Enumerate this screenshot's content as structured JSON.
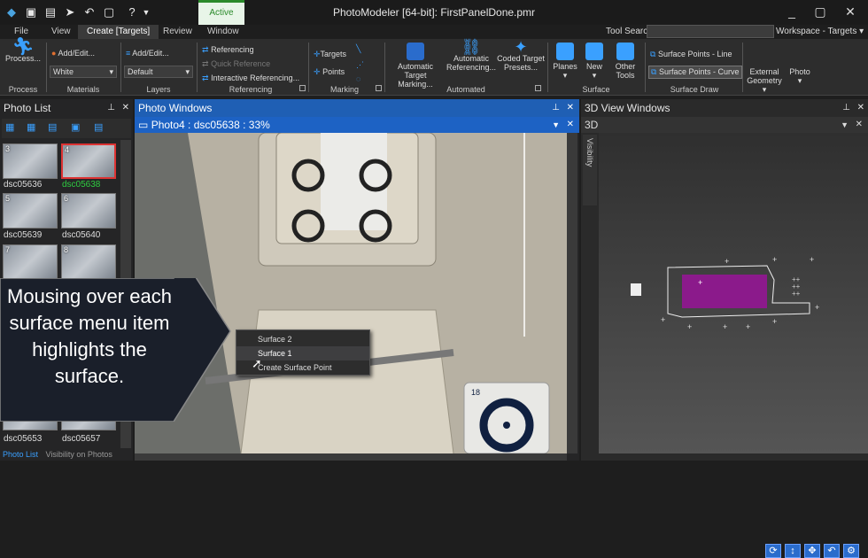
{
  "window": {
    "title": "PhotoModeler [64-bit]: FirstPanelDone.pmr",
    "context_tab": "Active"
  },
  "menu": {
    "tabs": [
      "File",
      "View",
      "Create [Targets]",
      "Review",
      "Window"
    ],
    "tool_search_label": "Tool Search",
    "tool_search_value": "",
    "workspace": "Workspace - Targets"
  },
  "ribbon": {
    "process_btn": "Process...",
    "process_group": "Process",
    "materials_add": "Add/Edit...",
    "materials_value": "White",
    "materials_group": "Materials",
    "layers_add": "Add/Edit...",
    "layers_value": "Default",
    "layers_group": "Layers",
    "ref_referencing": "Referencing",
    "ref_quick": "Quick Reference",
    "ref_interactive": "Interactive Referencing...",
    "ref_group": "Referencing",
    "mark_targets": "Targets",
    "mark_points": "Points",
    "mark_group": "Marking",
    "auto_target": "Automatic Target Marking...",
    "auto_ref": "Automatic Referencing...",
    "coded_target": "Coded Target Presets...",
    "auto_group": "Automated",
    "planes": "Planes",
    "new": "New",
    "other_tools": "Other Tools",
    "surface_group": "Surface",
    "sp_line": "Surface Points - Line",
    "sp_curve": "Surface Points - Curve",
    "surface_draw_group": "Surface Draw",
    "external_geometry": "External Geometry",
    "photo": "Photo"
  },
  "photo_list": {
    "title": "Photo List",
    "thumbs": [
      {
        "num": "3",
        "name": "dsc05636"
      },
      {
        "num": "4",
        "name": "dsc05638"
      },
      {
        "num": "5",
        "name": "dsc05639"
      },
      {
        "num": "6",
        "name": "dsc05640"
      },
      {
        "num": "7",
        "name": ""
      },
      {
        "num": "8",
        "name": ""
      }
    ],
    "bottom_names": [
      "dsc05653",
      "dsc05657"
    ],
    "bottom_tabs": [
      "Photo List",
      "Visibility on Photos"
    ]
  },
  "photo_windows": {
    "title": "Photo Windows",
    "subtitle": "Photo4 : dsc05638 : 33%"
  },
  "view3d": {
    "title": "3D View Windows",
    "subtitle": "3D",
    "side_tab": "Visibility"
  },
  "context_menu": {
    "items": [
      "Surface 2",
      "Surface 1",
      "Create Surface Point"
    ]
  },
  "callout": {
    "text": "Mousing over each surface menu item highlights the surface."
  },
  "photo_overlay": {
    "target_number": "18"
  },
  "colors": {
    "accent": "#1f5fb4",
    "surface_highlight": "#8b1a8b",
    "selected_thumb": "#dd3333",
    "active_green": "#2a8a2a"
  }
}
